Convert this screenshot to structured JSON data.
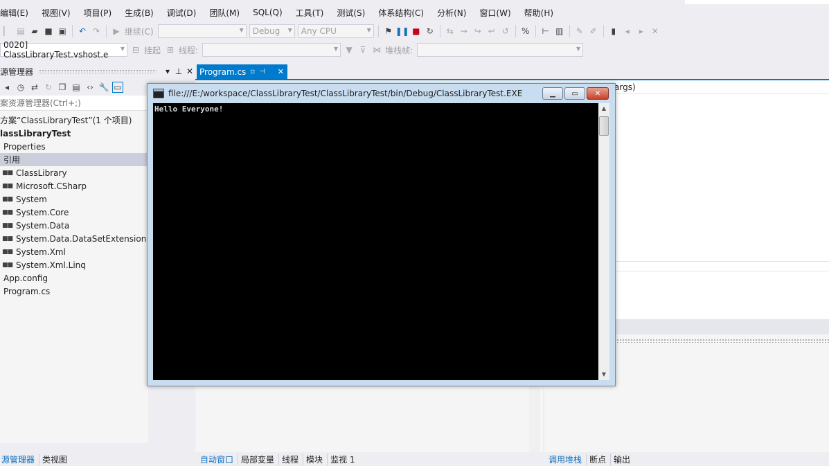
{
  "menu": [
    "编辑(E)",
    "视图(V)",
    "项目(P)",
    "生成(B)",
    "调试(D)",
    "团队(M)",
    "SQL(Q)",
    "工具(T)",
    "测试(S)",
    "体系结构(C)",
    "分析(N)",
    "窗口(W)",
    "帮助(H)"
  ],
  "toolbar": {
    "continue_label": "继续(C)",
    "config": "Debug",
    "platform": "Any CPU",
    "process": "0020] ClassLibraryTest.vshost.e",
    "suspend_label": "挂起",
    "thread_label": "线程:",
    "stack_label": "堆栈帧:"
  },
  "solution_explorer": {
    "title": "源管理器",
    "search_placeholder": "案资源管理器(Ctrl+;)",
    "tree": {
      "solution": "方案“ClassLibraryTest”(1 个项目)",
      "project": "lassLibraryTest",
      "properties": "Properties",
      "references": "引用",
      "refs": [
        "ClassLibrary",
        "Microsoft.CSharp",
        "System",
        "System.Core",
        "System.Data",
        "System.Data.DataSetExtensions",
        "System.Xml",
        "System.Xml.Linq"
      ],
      "app_config": "App.config",
      "program": "Program.cs"
    }
  },
  "editor": {
    "tab_label": "Program.cs",
    "code_fragment": "args)"
  },
  "console": {
    "title": "file:///E:/workspace/ClassLibraryTest/ClassLibraryTest/bin/Debug/ClassLibraryTest.EXE",
    "output": "Hello Everyone!"
  },
  "bottom_tabs": {
    "left": [
      "源管理器",
      "类视图"
    ],
    "middle": [
      "自动窗口",
      "局部变量",
      "线程",
      "模块",
      "监视 1"
    ],
    "right": [
      "调用堆栈",
      "断点",
      "输出"
    ]
  },
  "colors": {
    "accent": "#007ACC",
    "stop": "#C8001C",
    "console_bg": "#000000"
  }
}
